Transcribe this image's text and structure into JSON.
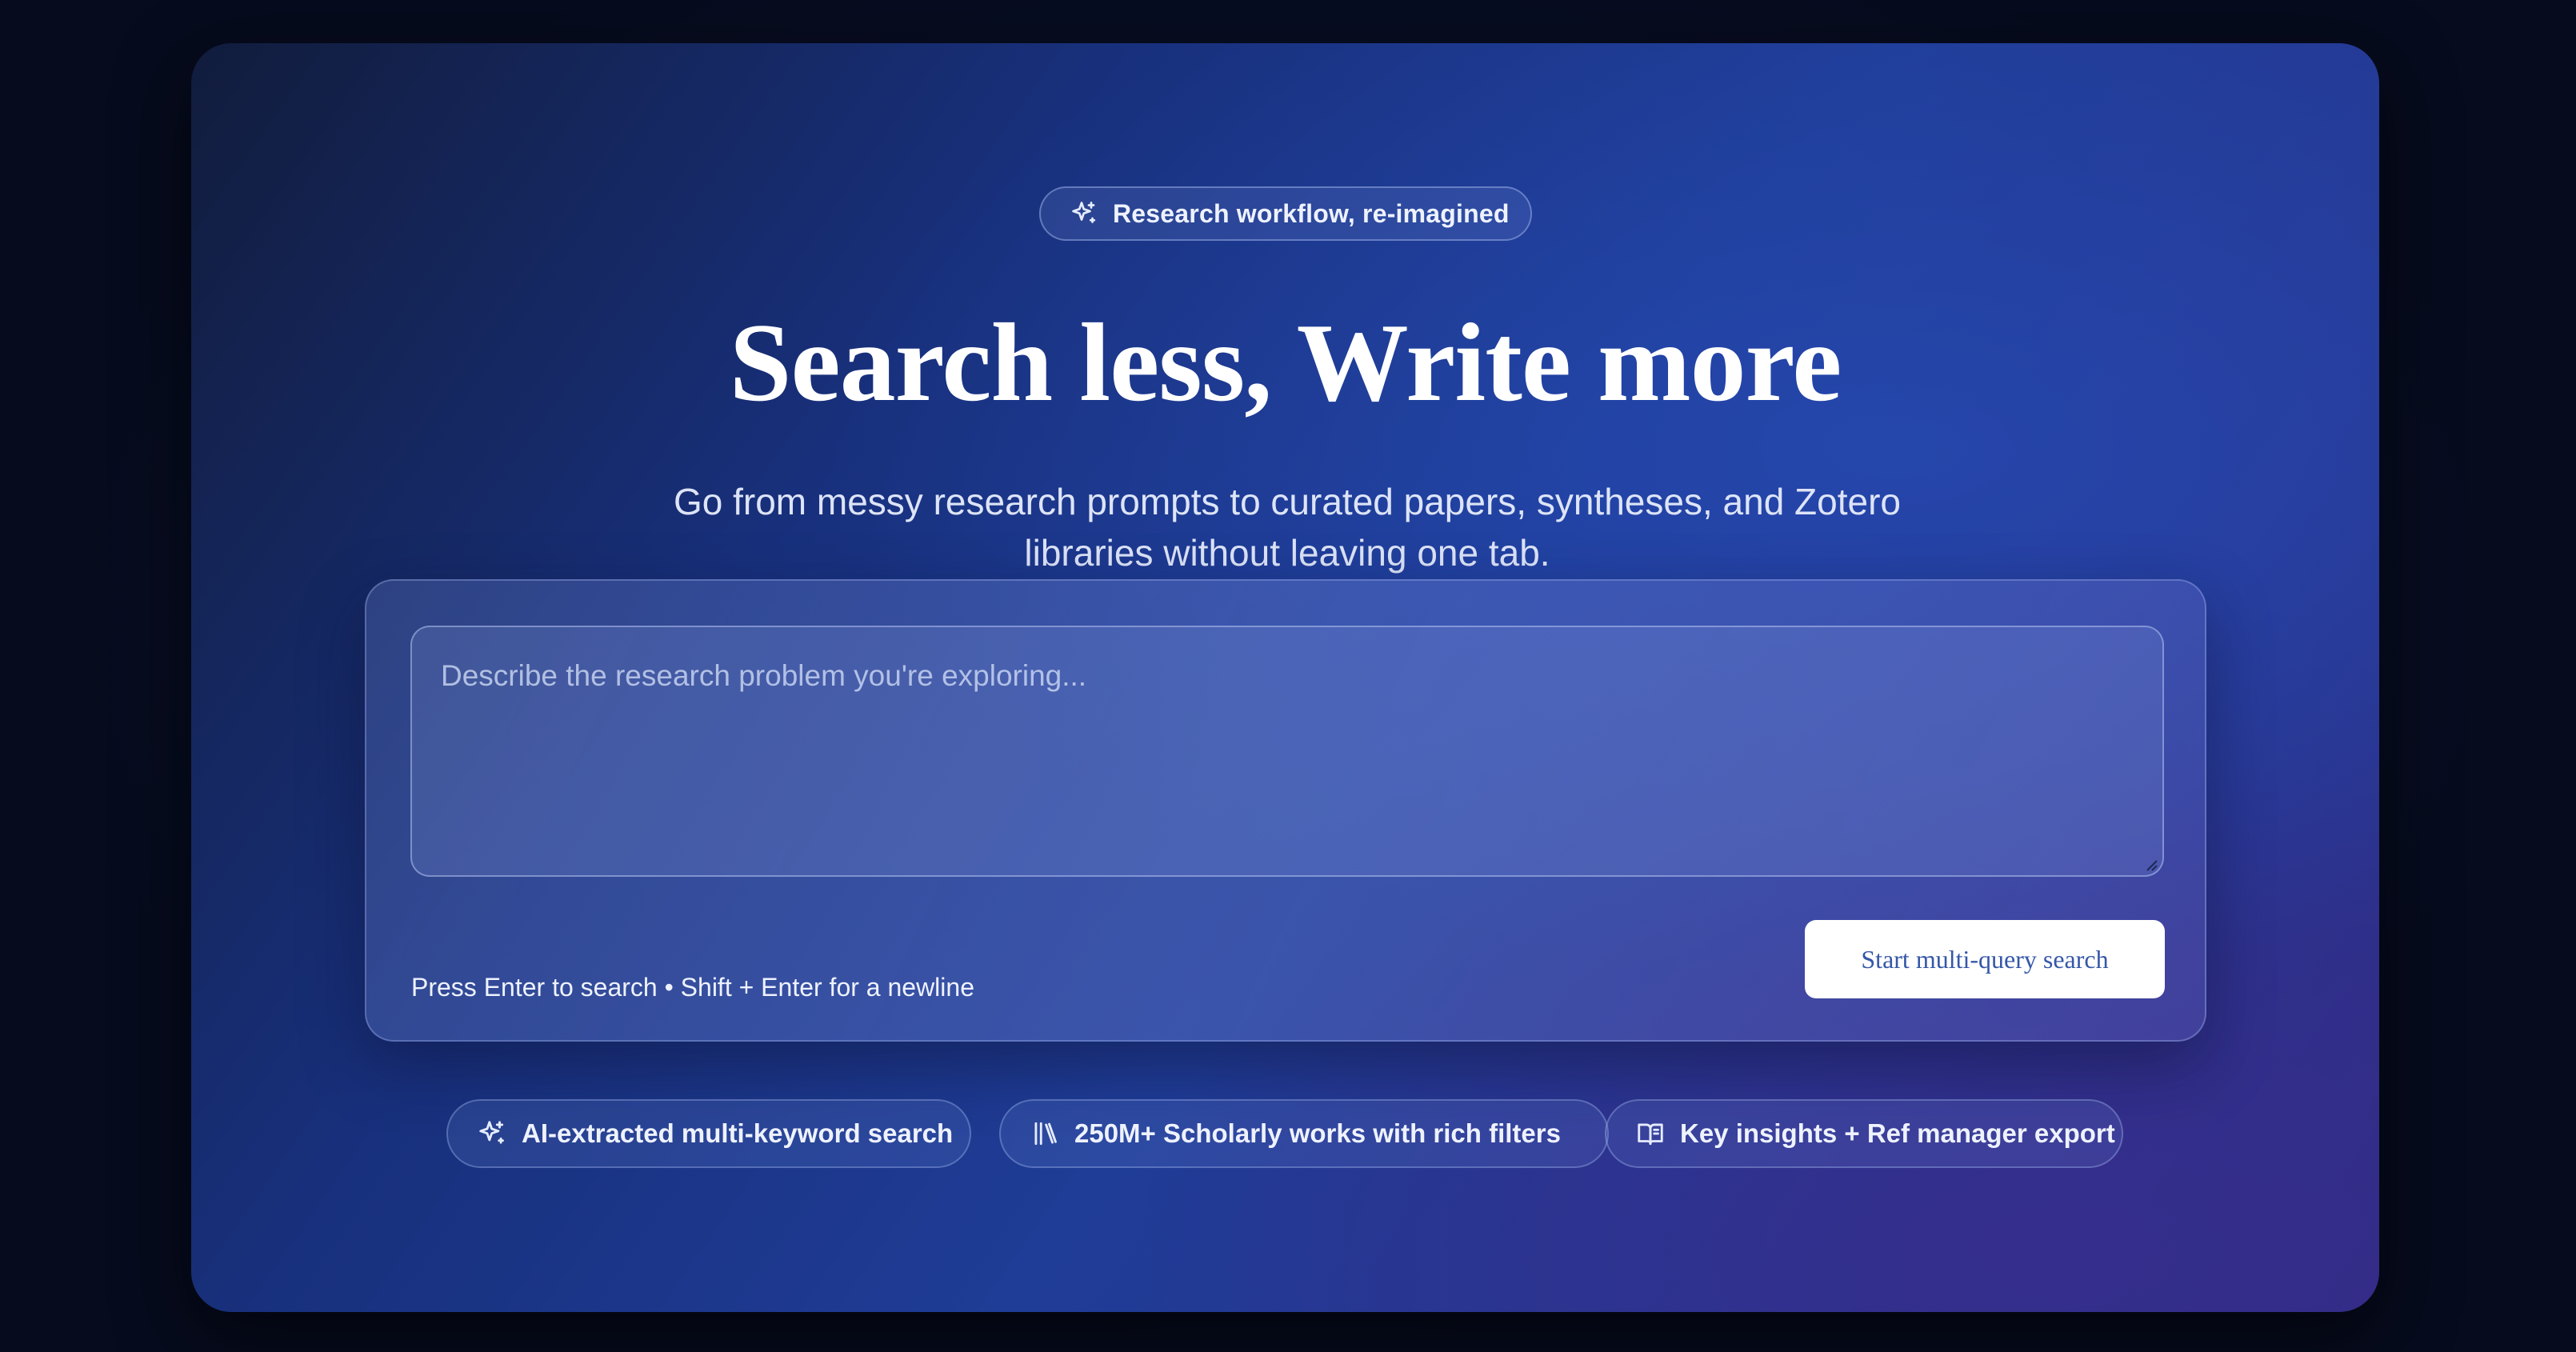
{
  "badge": {
    "label": "Research workflow, re-imagined",
    "icon": "sparkles-icon"
  },
  "hero": {
    "title": "Search less, Write more",
    "subtitle": "Go from messy research prompts to curated papers, syntheses, and Zotero libraries without leaving one tab."
  },
  "search": {
    "placeholder": "Describe the research problem you're exploring...",
    "value": "",
    "hint": "Press Enter to search • Shift + Enter for a newline",
    "submit_label": "Start multi-query search"
  },
  "features": [
    {
      "label": "AI-extracted multi-keyword search",
      "icon": "sparkles-icon"
    },
    {
      "label": "250M+ Scholarly works with rich filters",
      "icon": "library-icon"
    },
    {
      "label": "Key insights + Ref manager export",
      "icon": "book-open-icon"
    }
  ],
  "colors": {
    "page_background": "#060b1d",
    "card_gradient_start": "#111c3c",
    "card_gradient_mid": "#1f3c96",
    "card_gradient_end": "#2f2b82",
    "button_text": "#3557a8"
  }
}
